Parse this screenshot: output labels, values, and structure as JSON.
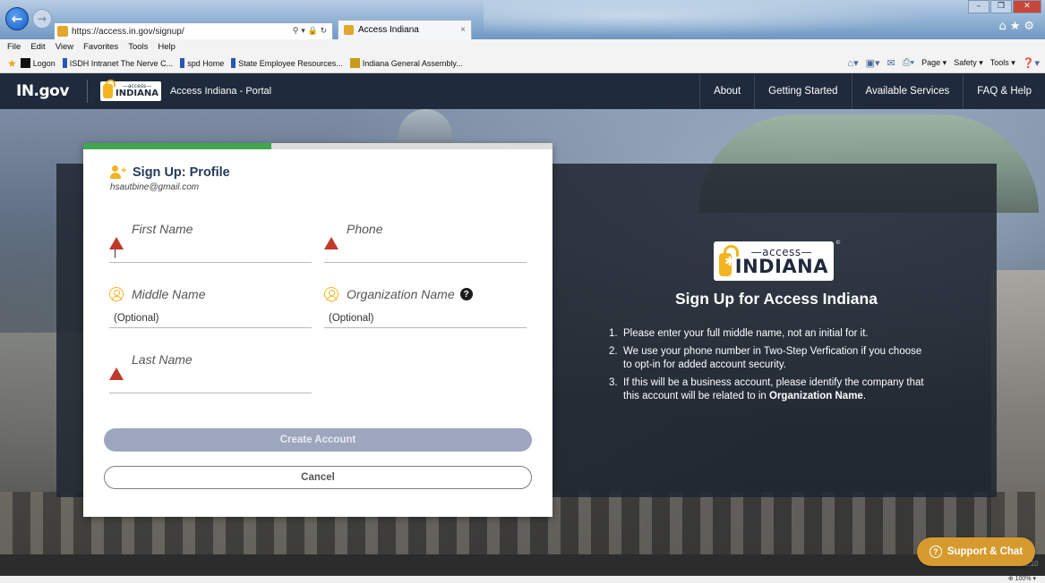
{
  "browser": {
    "url": "https://access.in.gov/signup/",
    "tab_title": "Access Indiana",
    "tab_close": "×",
    "menu": [
      "File",
      "Edit",
      "View",
      "Favorites",
      "Tools",
      "Help"
    ],
    "favorites": [
      "Logon",
      "ISDH Intranet The Nerve C...",
      "spd Home",
      "State Employee Resources...",
      "Indiana General Assembly..."
    ],
    "commands": [
      "Page ▾",
      "Safety ▾",
      "Tools ▾"
    ],
    "zoom": "100%"
  },
  "header": {
    "ingov": "IN.gov",
    "logo_small_top": "—access—",
    "logo_small_bottom": "INDIANA",
    "portal_title": "Access Indiana - Portal",
    "nav": [
      "About",
      "Getting Started",
      "Available Services",
      "FAQ & Help"
    ]
  },
  "form": {
    "progress": 0.4,
    "title": "Sign Up: Profile",
    "email": "hsautbine@gmail.com",
    "first_name_label": "First Name",
    "first_name_value": "|",
    "phone_label": "Phone",
    "middle_name_label": "Middle Name",
    "middle_name_placeholder": "(Optional)",
    "org_name_label": "Organization Name",
    "org_name_placeholder": "(Optional)",
    "last_name_label": "Last Name",
    "create_button": "Create Account",
    "cancel_button": "Cancel"
  },
  "info": {
    "logo_top": "—access—",
    "logo_bottom": "INDIANA",
    "title": "Sign Up for Access Indiana",
    "items": [
      {
        "num": "1.",
        "text": "Please enter your full middle name, not an initial for it."
      },
      {
        "num": "2.",
        "text": "We use your phone number in Two-Step Verfication if you choose to opt-in for added account security."
      },
      {
        "num": "3.",
        "text_before": "If this will be a business account, please identify the company that this account will be related to in ",
        "bold": "Organization Name",
        "text_after": "."
      }
    ]
  },
  "support": {
    "label": "Support & Chat"
  },
  "version": "v2.10",
  "colors": {
    "accent": "#f2b51f",
    "header": "#1f2a3c",
    "progress": "#3fa64f",
    "warning": "#c0392b",
    "support": "#d69a2e"
  }
}
